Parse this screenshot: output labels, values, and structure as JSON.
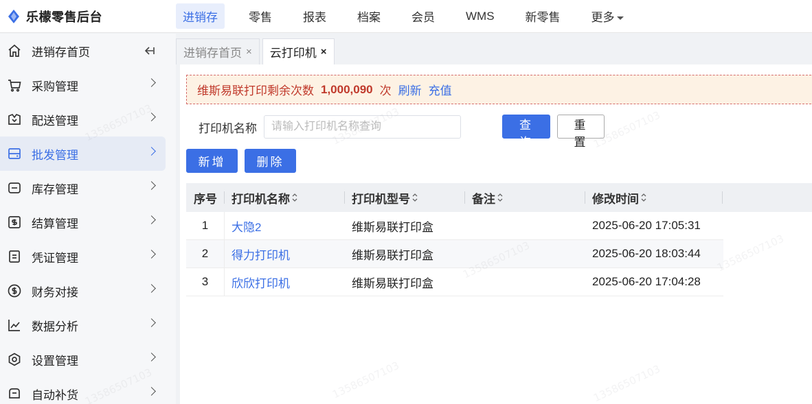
{
  "brand": {
    "name": "乐檬零售后台",
    "color": "#3b6fe5"
  },
  "topnav": [
    {
      "label": "进销存",
      "active": true
    },
    {
      "label": "零售"
    },
    {
      "label": "报表"
    },
    {
      "label": "档案"
    },
    {
      "label": "会员"
    },
    {
      "label": "WMS"
    },
    {
      "label": "新零售"
    },
    {
      "label": "更多",
      "caret": true
    }
  ],
  "sidebar": {
    "items": [
      {
        "label": "进销存首页",
        "icon": "home-icon"
      },
      {
        "label": "采购管理",
        "icon": "cart-icon"
      },
      {
        "label": "配送管理",
        "icon": "delivery-box-icon"
      },
      {
        "label": "批发管理",
        "icon": "wholesale-icon",
        "active": true
      },
      {
        "label": "库存管理",
        "icon": "inventory-icon"
      },
      {
        "label": "结算管理",
        "icon": "settlement-icon"
      },
      {
        "label": "凭证管理",
        "icon": "voucher-icon"
      },
      {
        "label": "财务对接",
        "icon": "finance-icon"
      },
      {
        "label": "数据分析",
        "icon": "chart-line-icon"
      },
      {
        "label": "设置管理",
        "icon": "settings-icon"
      },
      {
        "label": "自动补货",
        "icon": "auto-restock-icon"
      }
    ]
  },
  "tabs": [
    {
      "label": "进销存首页",
      "close": "×"
    },
    {
      "label": "云打印机",
      "close": "×",
      "active": true
    }
  ],
  "notice": {
    "text": "维斯易联打印剩余次数",
    "count": "1,000,090",
    "unit": "次",
    "refresh": "刷新",
    "recharge": "充值"
  },
  "search": {
    "label": "打印机名称",
    "placeholder": "请输入打印机名称查询",
    "query_label": "查询",
    "reset_label": "重置"
  },
  "actions": {
    "add_label": "新增",
    "delete_label": "删除"
  },
  "table": {
    "headers": [
      "序号",
      "打印机名称",
      "打印机型号",
      "备注",
      "修改时间"
    ],
    "rows": [
      {
        "no": "1",
        "name": "大隐2",
        "model": "维斯易联打印盒",
        "remark": "",
        "time": "2025-06-20 17:05:31"
      },
      {
        "no": "2",
        "name": "得力打印机",
        "model": "维斯易联打印盒",
        "remark": "",
        "time": "2025-06-20 18:03:44"
      },
      {
        "no": "3",
        "name": "欣欣打印机",
        "model": "维斯易联打印盒",
        "remark": "",
        "time": "2025-06-20 17:04:28"
      }
    ]
  },
  "watermark": "13586507103"
}
